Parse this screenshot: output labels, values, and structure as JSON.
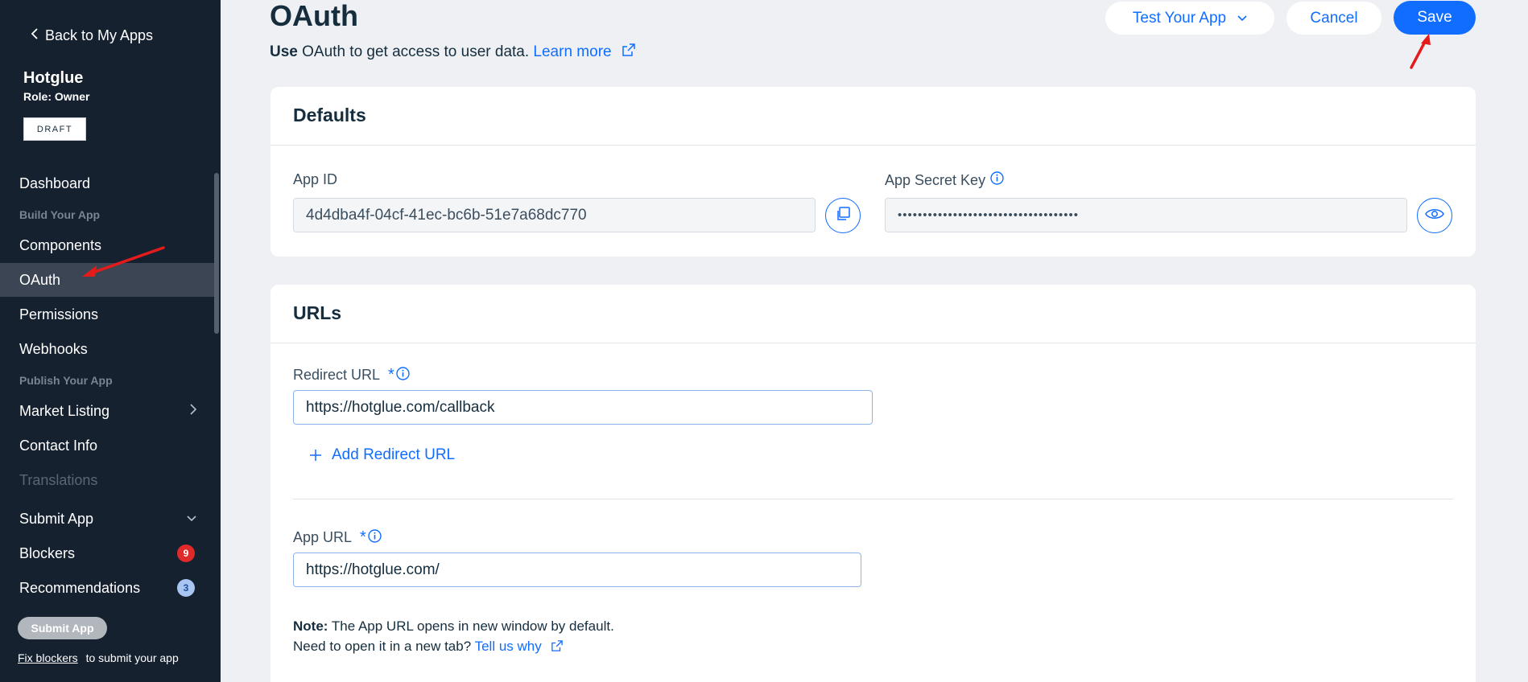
{
  "sidebar": {
    "back_label": "Back to My Apps",
    "app_name": "Hotglue",
    "role": "Role: Owner",
    "status": "DRAFT",
    "items": {
      "dashboard": "Dashboard",
      "section_build": "Build Your App",
      "components": "Components",
      "oauth": "OAuth",
      "permissions": "Permissions",
      "webhooks": "Webhooks",
      "section_publish": "Publish Your App",
      "market_listing": "Market Listing",
      "contact_info": "Contact Info",
      "translations": "Translations",
      "submit_app": "Submit App",
      "blockers": "Blockers",
      "blockers_count": "9",
      "recommendations": "Recommendations",
      "recommendations_count": "3"
    },
    "submit_button": "Submit App",
    "fix_link": "Fix blockers",
    "fix_suffix": "to submit your app"
  },
  "header": {
    "title": "OAuth",
    "subtitle_bold": "Use",
    "subtitle_rest": "OAuth to get access to user data.",
    "learn_more": "Learn more",
    "test_app": "Test Your App",
    "cancel": "Cancel",
    "save": "Save"
  },
  "defaults": {
    "title": "Defaults",
    "app_id_label": "App ID",
    "app_id_value": "4d4dba4f-04cf-41ec-bc6b-51e7a68dc770",
    "secret_label": "App Secret Key",
    "secret_value": "••••••••••••••••••••••••••••••••••••"
  },
  "urls": {
    "title": "URLs",
    "redirect_label": "Redirect URL",
    "redirect_value": "https://hotglue.com/callback",
    "add_redirect": "Add Redirect URL",
    "app_url_label": "App URL",
    "app_url_value": "https://hotglue.com/",
    "required_mark": "*",
    "note_bold": "Note:",
    "note_text": "The App URL opens in new window by default.",
    "note_line2": "Need to open it in a new tab?",
    "tell_us": "Tell us why"
  },
  "colors": {
    "accent": "#116dff",
    "sidebar_bg": "#162130",
    "annotation_arrow": "#e41b1b"
  }
}
